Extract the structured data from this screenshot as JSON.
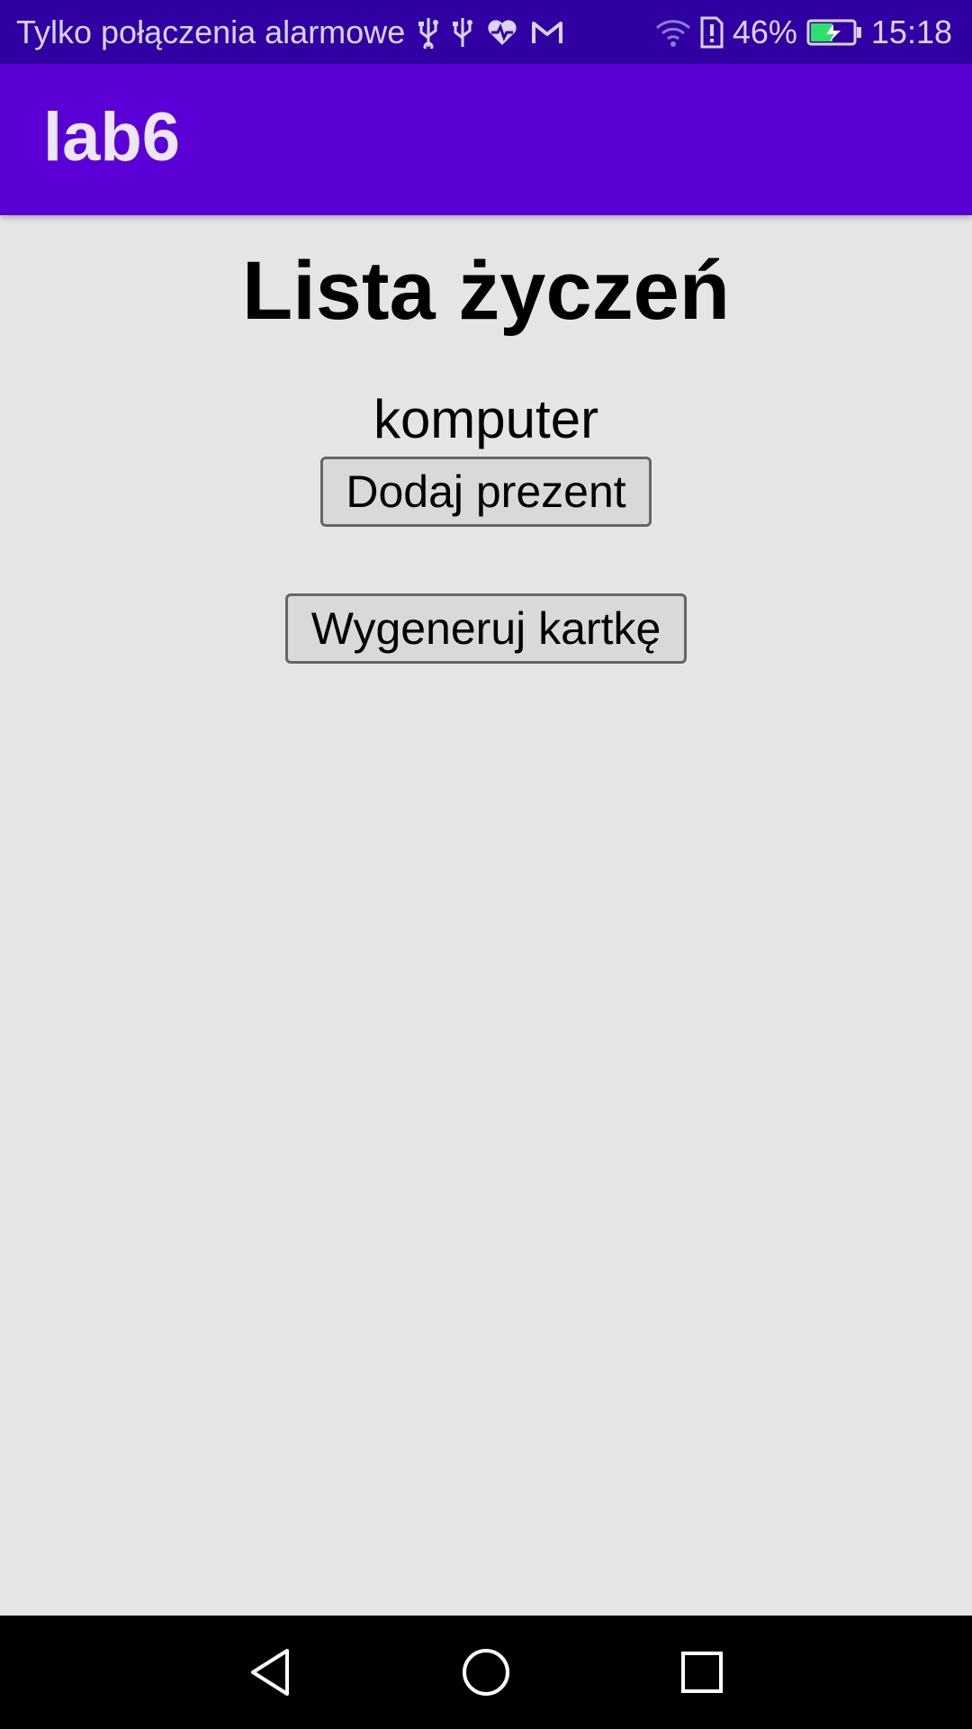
{
  "status_bar": {
    "carrier_text": "Tylko połączenia alarmowe",
    "battery_percent": "46%",
    "time": "15:18",
    "icons_left": [
      "usb-icon",
      "usb-icon",
      "health-icon",
      "gmail-icon"
    ],
    "icons_right": [
      "wifi-icon",
      "sim-alert-icon",
      "battery-charging-icon"
    ]
  },
  "app_bar": {
    "title": "lab6",
    "color": "#5a00d6"
  },
  "main": {
    "title": "Lista życzeń",
    "wish_items": [
      "komputer"
    ],
    "add_button_label": "Dodaj prezent",
    "generate_button_label": "Wygeneruj kartkę"
  },
  "nav_bar": {
    "icons": [
      "back-icon",
      "home-icon",
      "recent-apps-icon"
    ]
  },
  "colors": {
    "status_bar": "#3000a3",
    "app_bar": "#5a00d6",
    "background": "#e5e5e5"
  }
}
